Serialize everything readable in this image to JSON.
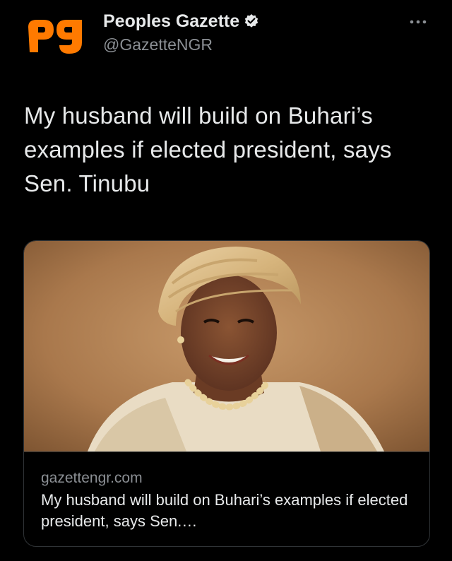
{
  "account": {
    "display_name": "Peoples Gazette",
    "handle": "@GazetteNGR",
    "logo_text": "pg",
    "logo_color": "#ff7a00",
    "verified": true
  },
  "tweet": {
    "text": "My husband will build on Buhari’s examples if elected president, says Sen. Tinubu"
  },
  "link_card": {
    "domain": "gazettengr.com",
    "title": "My husband will build on Buhari’s examples if elected president, says Sen.…"
  },
  "icons": {
    "more": "more-horizontal-icon",
    "verified": "verified-badge-icon"
  },
  "colors": {
    "background": "#000000",
    "text_primary": "#e7e9ea",
    "text_secondary": "#8b8f94",
    "border": "#2f3336"
  }
}
